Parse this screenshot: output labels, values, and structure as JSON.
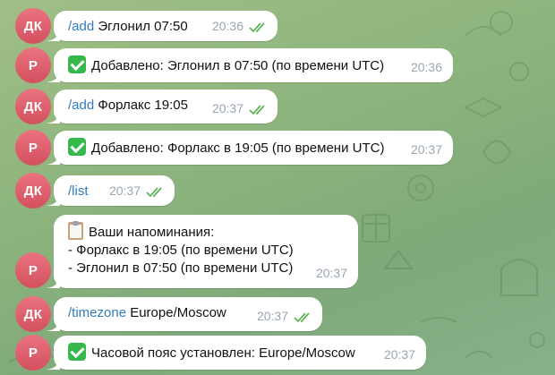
{
  "messages": [
    {
      "avatar": "ДК",
      "command": "/add",
      "text": " Эглонил 07:50",
      "time": "20:36",
      "read": true
    },
    {
      "avatar": "Р",
      "icon": "check-mark",
      "text": "Добавлено: Эглонил в 07:50 (по времени UTC)",
      "time": "20:36"
    },
    {
      "avatar": "ДК",
      "command": "/add",
      "text": " Форлакс 19:05",
      "time": "20:37",
      "read": true
    },
    {
      "avatar": "Р",
      "icon": "check-mark",
      "text": "Добавлено: Форлакс в 19:05 (по времени UTC)",
      "time": "20:37"
    },
    {
      "avatar": "ДК",
      "command": "/list",
      "text": "",
      "time": "20:37",
      "read": true
    },
    {
      "avatar": "Р",
      "icon": "clipboard",
      "lines": [
        "Ваши напоминания:",
        "- Форлакс в 19:05 (по времени UTC)",
        "- Эглонил в 07:50 (по времени UTC)"
      ],
      "time": "20:37"
    },
    {
      "avatar": "ДК",
      "command": "/timezone",
      "text": " Europe/Moscow",
      "time": "20:37",
      "read": true
    },
    {
      "avatar": "Р",
      "icon": "check-mark",
      "text": "Часовой пояс установлен: Europe/Moscow",
      "time": "20:37"
    }
  ]
}
